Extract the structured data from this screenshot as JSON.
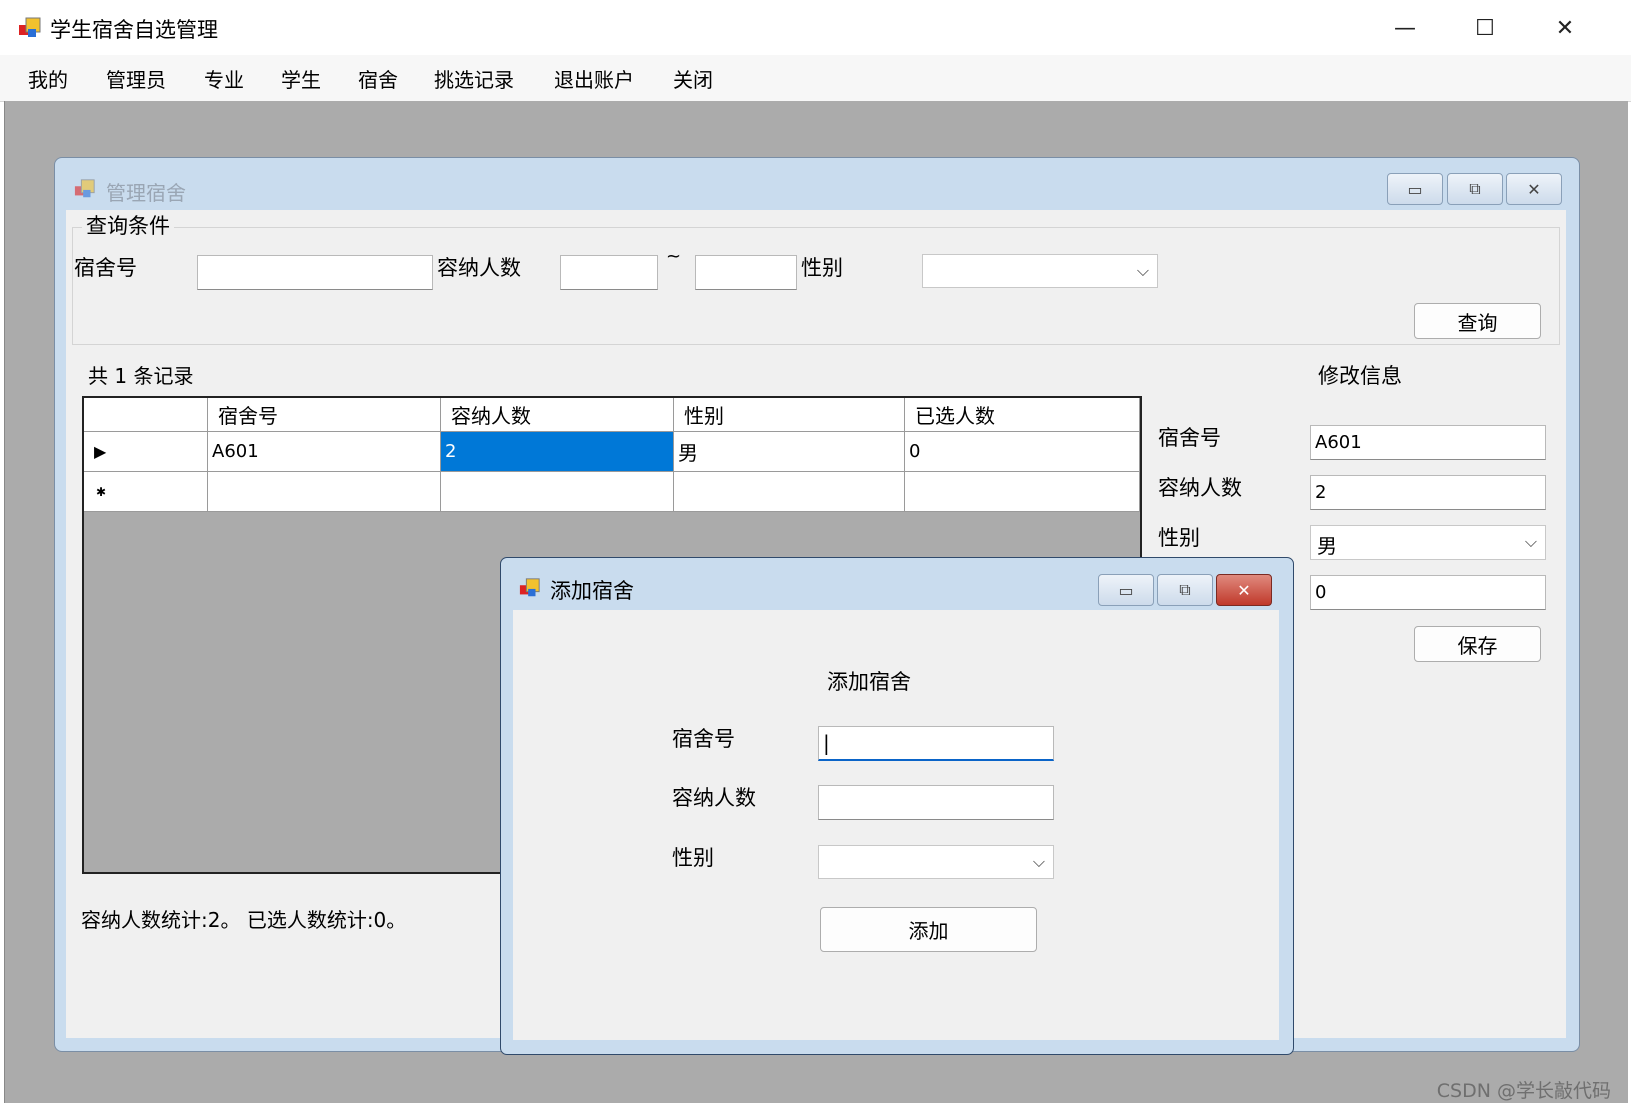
{
  "window": {
    "title": "学生宿舍自选管理",
    "icon": "app-icon",
    "min_glyph": "—",
    "max_glyph": "☐",
    "close_glyph": "✕"
  },
  "menu": [
    "我的",
    "管理员",
    "专业",
    "学生",
    "宿舍",
    "挑选记录",
    "退出账户",
    "关闭"
  ],
  "manage": {
    "title": "管理宿舍",
    "query_group": "查询条件",
    "label_room": "宿舍号",
    "label_capacity": "容纳人数",
    "range_sep": "~",
    "label_gender": "性别",
    "query_button": "查询",
    "room_value": "",
    "cap_min_value": "",
    "cap_max_value": "",
    "gender_value": "",
    "record_count": "共 1 条记录",
    "edit_title": "修改信息",
    "edit": {
      "label_room": "宿舍号",
      "room_value": "A601",
      "label_capacity": "容纳人数",
      "capacity_value": "2",
      "label_gender": "性别",
      "gender_value": "男",
      "selected_value": "0",
      "save_button": "保存"
    },
    "stats": "容纳人数统计:2。 已选人数统计:0。"
  },
  "grid": {
    "columns": [
      "宿舍号",
      "容纳人数",
      "性别",
      "已选人数"
    ],
    "rows": [
      {
        "indicator": "▶",
        "cells": [
          "A601",
          "2",
          "男",
          "0"
        ]
      },
      {
        "indicator": "✱",
        "cells": [
          "",
          "",
          "",
          ""
        ]
      }
    ]
  },
  "dialog": {
    "title": "添加宿舍",
    "heading": "添加宿舍",
    "label_room": "宿舍号",
    "label_capacity": "容纳人数",
    "label_gender": "性别",
    "room_value": "|",
    "capacity_value": "",
    "gender_value": "",
    "add_button": "添加",
    "close_glyph": "✕"
  },
  "watermark": "CSDN @学长敲代码",
  "colors": {
    "mdi_background": "#ababab",
    "selection": "#0078d7",
    "close_red": "#c94a3c"
  }
}
